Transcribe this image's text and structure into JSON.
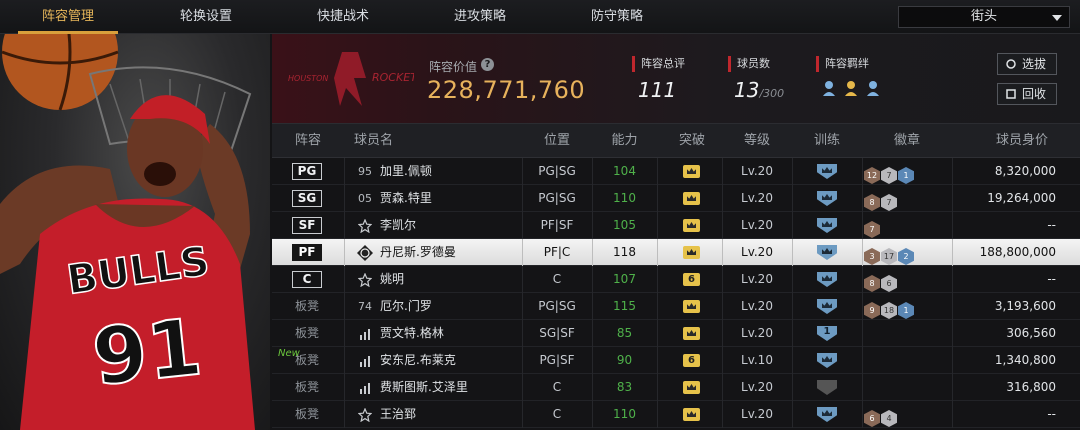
{
  "tabs": [
    {
      "label": "阵容管理",
      "active": true
    },
    {
      "label": "轮换设置",
      "active": false
    },
    {
      "label": "快捷战术",
      "active": false
    },
    {
      "label": "进攻策略",
      "active": false
    },
    {
      "label": "防守策略",
      "active": false
    }
  ],
  "court_select": "街头",
  "header": {
    "team_logo_text": "ROCKETS",
    "lineup_value_label": "阵容价值",
    "lineup_value": "228,771,760",
    "total_rating_label": "阵容总评",
    "total_rating": "111",
    "player_count_label": "球员数",
    "player_count": "13",
    "player_count_max": "/300",
    "bond_label": "阵容羁绊",
    "select_button": "选拔",
    "recycle_button": "回收"
  },
  "columns": [
    "阵容",
    "球员名",
    "位置",
    "能力",
    "突破",
    "等级",
    "训练",
    "徽章",
    "球员身价"
  ],
  "rows": [
    {
      "slot": "PG",
      "slot_type": "pos",
      "num": "95",
      "num_type": "text",
      "name": "加里.佩顿",
      "position": "PG|SG",
      "ability": "104",
      "breakthrough": "crown",
      "level": "Lv.20",
      "training": "crown",
      "badges": [
        [
          "br",
          "12"
        ],
        [
          "sv",
          "7"
        ],
        [
          "bl",
          "1"
        ]
      ],
      "value": "8,320,000",
      "selected": false,
      "new": false
    },
    {
      "slot": "SG",
      "slot_type": "pos",
      "num": "05",
      "num_type": "text",
      "name": "贾森.特里",
      "position": "PG|SG",
      "ability": "110",
      "breakthrough": "crown",
      "level": "Lv.20",
      "training": "crown",
      "badges": [
        [
          "br",
          "8"
        ],
        [
          "sv",
          "7"
        ]
      ],
      "value": "19,264,000",
      "selected": false,
      "new": false
    },
    {
      "slot": "SF",
      "slot_type": "pos",
      "num": "",
      "num_type": "star",
      "name": "李凯尔",
      "position": "PF|SF",
      "ability": "105",
      "breakthrough": "crown",
      "level": "Lv.20",
      "training": "crown",
      "badges": [
        [
          "br",
          "7"
        ]
      ],
      "value": "--",
      "selected": false,
      "new": false
    },
    {
      "slot": "PF",
      "slot_type": "pos",
      "num": "",
      "num_type": "emblem",
      "name": "丹尼斯.罗德曼",
      "position": "PF|C",
      "ability": "118",
      "breakthrough": "crown",
      "level": "Lv.20",
      "training": "crown",
      "badges": [
        [
          "br",
          "3"
        ],
        [
          "sv",
          "17"
        ],
        [
          "bl",
          "2"
        ]
      ],
      "value": "188,800,000",
      "selected": true,
      "new": false
    },
    {
      "slot": "C",
      "slot_type": "pos",
      "num": "",
      "num_type": "star",
      "name": "姚明",
      "position": "C",
      "ability": "107",
      "breakthrough": "6",
      "level": "Lv.20",
      "training": "crown",
      "badges": [
        [
          "br",
          "8"
        ],
        [
          "sv",
          "6"
        ]
      ],
      "value": "--",
      "selected": false,
      "new": false
    },
    {
      "slot": "板凳",
      "slot_type": "bench",
      "num": "74",
      "num_type": "text",
      "name": "厄尔.门罗",
      "position": "PG|SG",
      "ability": "115",
      "breakthrough": "crown",
      "level": "Lv.20",
      "training": "crown",
      "badges": [
        [
          "br",
          "9"
        ],
        [
          "sv",
          "18"
        ],
        [
          "bl",
          "1"
        ]
      ],
      "value": "3,193,600",
      "selected": false,
      "new": false
    },
    {
      "slot": "板凳",
      "slot_type": "bench",
      "num": "",
      "num_type": "bars",
      "name": "贾文特.格林",
      "position": "SG|SF",
      "ability": "85",
      "breakthrough": "crown",
      "level": "Lv.20",
      "training": "1",
      "badges": [],
      "value": "306,560",
      "selected": false,
      "new": false
    },
    {
      "slot": "板凳",
      "slot_type": "bench",
      "num": "",
      "num_type": "bars",
      "name": "安东尼.布莱克",
      "position": "PG|SF",
      "ability": "90",
      "breakthrough": "6",
      "level": "Lv.10",
      "training": "crown",
      "badges": [],
      "value": "1,340,800",
      "selected": false,
      "new": true,
      "new_label": "New"
    },
    {
      "slot": "板凳",
      "slot_type": "bench",
      "num": "",
      "num_type": "bars",
      "name": "费斯图斯.艾泽里",
      "position": "C",
      "ability": "83",
      "breakthrough": "crown",
      "level": "Lv.20",
      "training": "gray",
      "badges": [],
      "value": "316,800",
      "selected": false,
      "new": false
    },
    {
      "slot": "板凳",
      "slot_type": "bench",
      "num": "",
      "num_type": "star",
      "name": "王治郅",
      "position": "C",
      "ability": "110",
      "breakthrough": "crown",
      "level": "Lv.20",
      "training": "crown",
      "badges": [
        [
          "br",
          "6"
        ],
        [
          "sv",
          "4"
        ]
      ],
      "value": "--",
      "selected": false,
      "new": false
    }
  ],
  "player_art": {
    "jersey_text": "BULLS",
    "jersey_number": "91"
  }
}
